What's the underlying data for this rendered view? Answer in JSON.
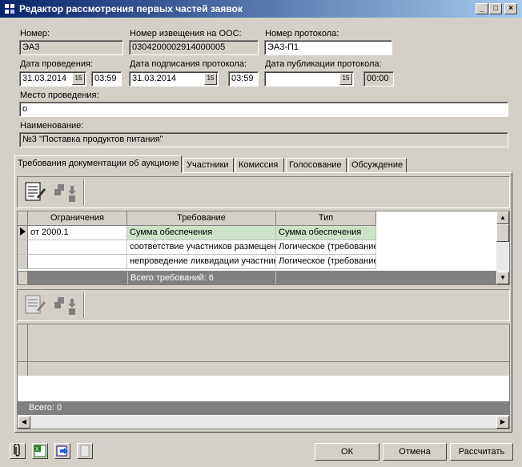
{
  "window": {
    "title": "Редактор рассмотрения первых частей заявок",
    "minimize": "_",
    "maximize": "□",
    "close": "×"
  },
  "form": {
    "number_label": "Номер:",
    "number_value": "ЭА3",
    "notice_label": "Номер извещения на ООС:",
    "notice_value": "0304200002914000005",
    "protocol_label": "Номер протокола:",
    "protocol_value": "ЭА3-П1",
    "date_held_label": "Дата проведения:",
    "date_held_value": "31.03.2014",
    "time_held_value": "03:59",
    "date_signed_label": "Дата подписания протокола:",
    "date_signed_value": "31.03.2014",
    "time_signed_value": "03:59",
    "date_published_label": "Дата публикации протокола:",
    "date_published_value": "",
    "time_published_value": "00:00",
    "place_label": "Место проведения:",
    "place_value": "о",
    "name_label": "Наименование:",
    "name_value": "№3 \"Поставка продуктов питания\""
  },
  "tabs": [
    {
      "label": "Требования документации об аукционе"
    },
    {
      "label": "Участники"
    },
    {
      "label": "Комиссия"
    },
    {
      "label": "Голосование"
    },
    {
      "label": "Обсуждение"
    }
  ],
  "requirements_grid": {
    "headers": [
      "Ограничения",
      "Требование",
      "Тип"
    ],
    "rows": [
      {
        "limit": "от 2000.1",
        "requirement": "Сумма обеспечения",
        "type": "Сумма обеспечения"
      },
      {
        "limit": "",
        "requirement": "соответствие участников размещения",
        "type": "Логическое (требование"
      },
      {
        "limit": "",
        "requirement": "непроведение ликвидации участника",
        "type": "Логическое (требование"
      }
    ],
    "footer_total": "Всего требований: 6"
  },
  "lower_grid": {
    "footer_total": "Всего: 0"
  },
  "buttons": {
    "ok": "ОК",
    "cancel": "Отмена",
    "calculate": "Рассчитать"
  },
  "colors": {
    "selected_row": "#cde3c8",
    "title_start": "#0a246a",
    "title_end": "#a6caf0"
  }
}
